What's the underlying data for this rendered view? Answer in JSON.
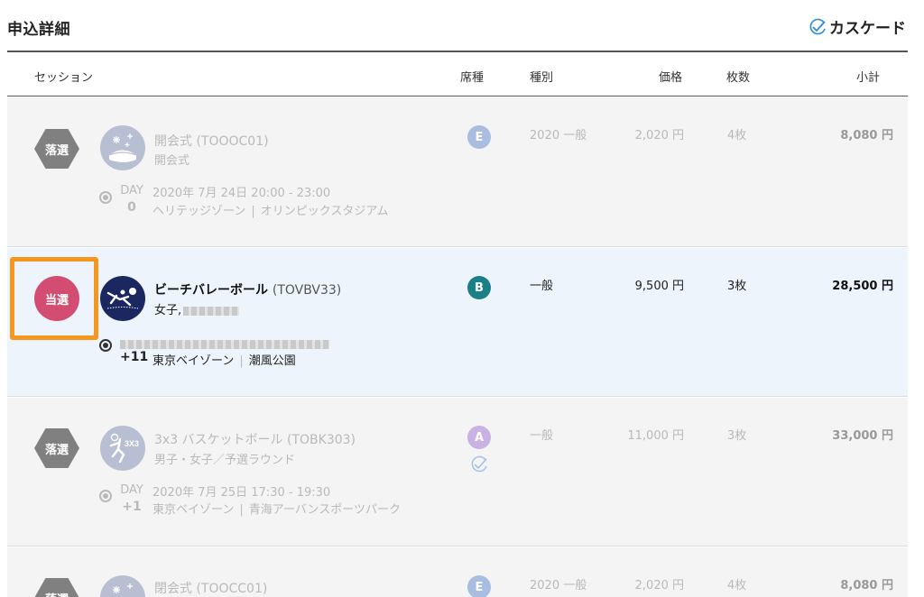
{
  "header": {
    "title": "申込詳細",
    "cascade_label": "カスケード"
  },
  "columns": {
    "session": "セッション",
    "seat": "席種",
    "category": "種別",
    "price": "価格",
    "qty": "枚数",
    "subtotal": "小計"
  },
  "colors": {
    "winner": "#d24d71",
    "loser": "#808080",
    "highlight": "#f5961e",
    "seat_E": "#a9bde0",
    "seat_B": "#1a7f86",
    "seat_A": "#c9b2e3",
    "row_bg": "#f4f4f4",
    "winner_bg": "#eef4fb"
  },
  "rows": [
    {
      "status": "落選",
      "icon": "fireworks-stadium-icon",
      "name": "開会式",
      "code": "(TOOOC01)",
      "subtitle": "開会式",
      "day_label": "DAY",
      "day_num": "0",
      "date": "2020年 7月 24日 20:00 - 23:00",
      "zone": "ヘリテッジゾーン",
      "venue": "オリンピックスタジアム",
      "seat": "E",
      "category": "2020 一般",
      "price": "2,020 円",
      "qty": "4枚",
      "subtotal": "8,080 円"
    },
    {
      "status": "当選",
      "icon": "beach-volleyball-icon",
      "name": "ビーチバレーボール",
      "code": "(TOVBV33)",
      "subtitle": "女子,",
      "day_num": "+11",
      "zone": "東京ベイゾーン",
      "venue": "潮風公園",
      "seat": "B",
      "category": "一般",
      "price": "9,500 円",
      "qty": "3枚",
      "subtotal": "28,500 円"
    },
    {
      "status": "落選",
      "icon": "3x3-basketball-icon",
      "name": "3x3 バスケットボール",
      "code": "(TOBK303)",
      "subtitle": "男子・女子／予選ラウンド",
      "day_label": "DAY",
      "day_num": "+1",
      "date": "2020年 7月 25日 17:30 - 19:30",
      "zone": "東京ベイゾーン",
      "venue": "青海アーバンスポーツパーク",
      "seat": "A",
      "category": "一般",
      "price": "11,000 円",
      "qty": "3枚",
      "subtotal": "33,000 円"
    },
    {
      "status": "落選",
      "icon": "fireworks-stadium-icon",
      "name": "閉会式",
      "code": "(TOOCC01)",
      "seat": "E",
      "category": "2020 一般",
      "price": "2,020 円",
      "qty": "4枚",
      "subtotal": "8,080 円"
    }
  ]
}
